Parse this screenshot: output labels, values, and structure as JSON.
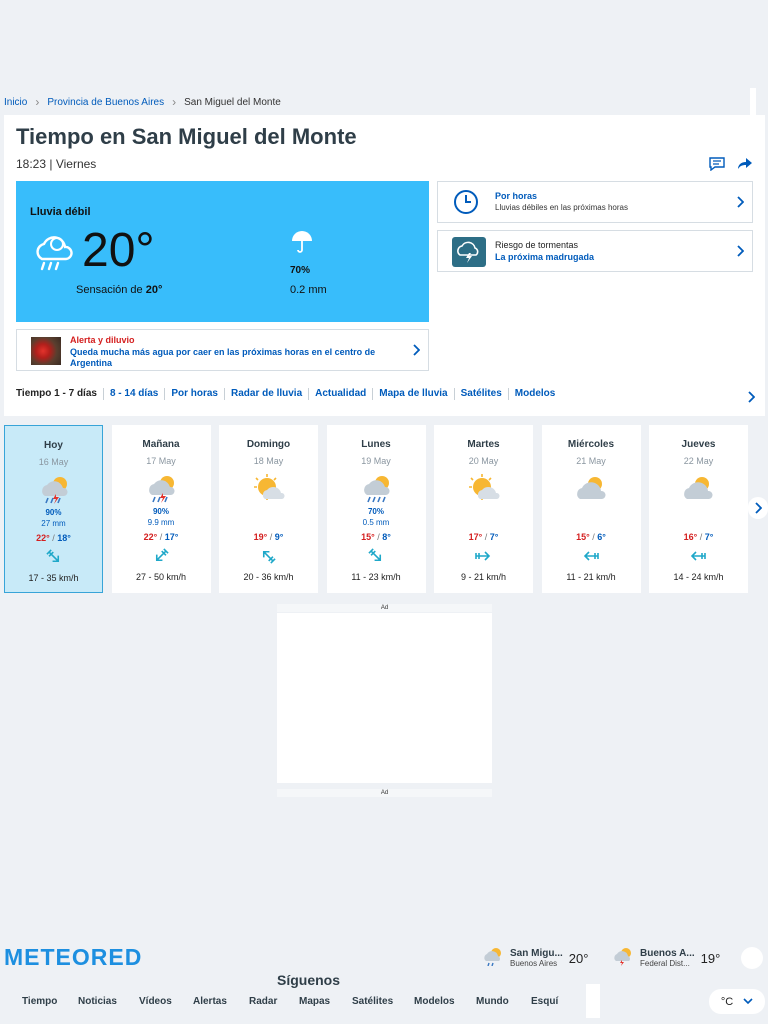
{
  "breadcrumb": {
    "home": "Inicio",
    "province": "Provincia de Buenos Aires",
    "current": "San Miguel del Monte"
  },
  "header": {
    "title": "Tiempo en San Miguel del Monte",
    "time": "18:23 | Viernes"
  },
  "current": {
    "condition": "Lluvia débil",
    "temp": "20°",
    "feels_label": "Sensación de",
    "feels_value": "20°",
    "rain_prob": "70%",
    "rain_amount": "0.2 mm",
    "icon": "rain-cloud-icon",
    "bg_color": "#38bdfb"
  },
  "alert": {
    "heading": "Alerta y diluvio",
    "text": "Queda mucha más agua por caer en las próximas horas en el centro de Argentina"
  },
  "hourly_box": {
    "title": "Por horas",
    "subtitle": "Lluvias débiles en las próximas horas"
  },
  "storm_box": {
    "title": "Riesgo de tormentas",
    "subtitle": "La próxima madrugada"
  },
  "tabs": [
    "Tiempo 1 - 7 días",
    "8 - 14 días",
    "Por horas",
    "Radar de lluvia",
    "Actualidad",
    "Mapa de lluvia",
    "Satélites",
    "Modelos"
  ],
  "days": [
    {
      "name": "Hoy",
      "date": "16 May",
      "icon": "storm-icon",
      "prob": "90%",
      "mm": "27 mm",
      "max": "22°",
      "min": "18°",
      "wind": "17 - 35 km/h",
      "dir": 45,
      "active": true
    },
    {
      "name": "Mañana",
      "date": "17 May",
      "icon": "storm-icon",
      "prob": "90%",
      "mm": "9.9 mm",
      "max": "22°",
      "min": "17°",
      "wind": "27 - 50 km/h",
      "dir": 135
    },
    {
      "name": "Domingo",
      "date": "18 May",
      "icon": "sun-cloud-icon",
      "prob": "",
      "mm": "",
      "max": "19°",
      "min": "9°",
      "wind": "20 - 36 km/h",
      "dir": 225
    },
    {
      "name": "Lunes",
      "date": "19 May",
      "icon": "rain-sun-icon",
      "prob": "70%",
      "mm": "0.5 mm",
      "max": "15°",
      "min": "8°",
      "wind": "11 - 23 km/h",
      "dir": 45
    },
    {
      "name": "Martes",
      "date": "20 May",
      "icon": "sun-cloud-icon",
      "prob": "",
      "mm": "",
      "max": "17°",
      "min": "7°",
      "wind": "9 - 21 km/h",
      "dir": 0
    },
    {
      "name": "Miércoles",
      "date": "21 May",
      "icon": "cloud-sun-icon",
      "prob": "",
      "mm": "",
      "max": "15°",
      "min": "6°",
      "wind": "11 - 21 km/h",
      "dir": 180
    },
    {
      "name": "Jueves",
      "date": "22 May",
      "icon": "cloud-sun-icon",
      "prob": "",
      "mm": "",
      "max": "16°",
      "min": "7°",
      "wind": "14 - 24 km/h",
      "dir": 180
    }
  ],
  "ad": {
    "label_top": "Ad",
    "label_bottom": "Ad"
  },
  "footer": {
    "logo": "METEORED",
    "follow": "Síguenos",
    "nav": [
      "Tiempo",
      "Noticias",
      "Vídeos",
      "Alertas",
      "Radar",
      "Mapas",
      "Satélites",
      "Modelos",
      "Mundo",
      "Esquí"
    ],
    "unit": "°C",
    "favs": [
      {
        "name": "San Migu...",
        "region": "Buenos Aires",
        "temp": "20°"
      },
      {
        "name": "Buenos A...",
        "region": "Federal Dist...",
        "temp": "19°"
      }
    ]
  }
}
